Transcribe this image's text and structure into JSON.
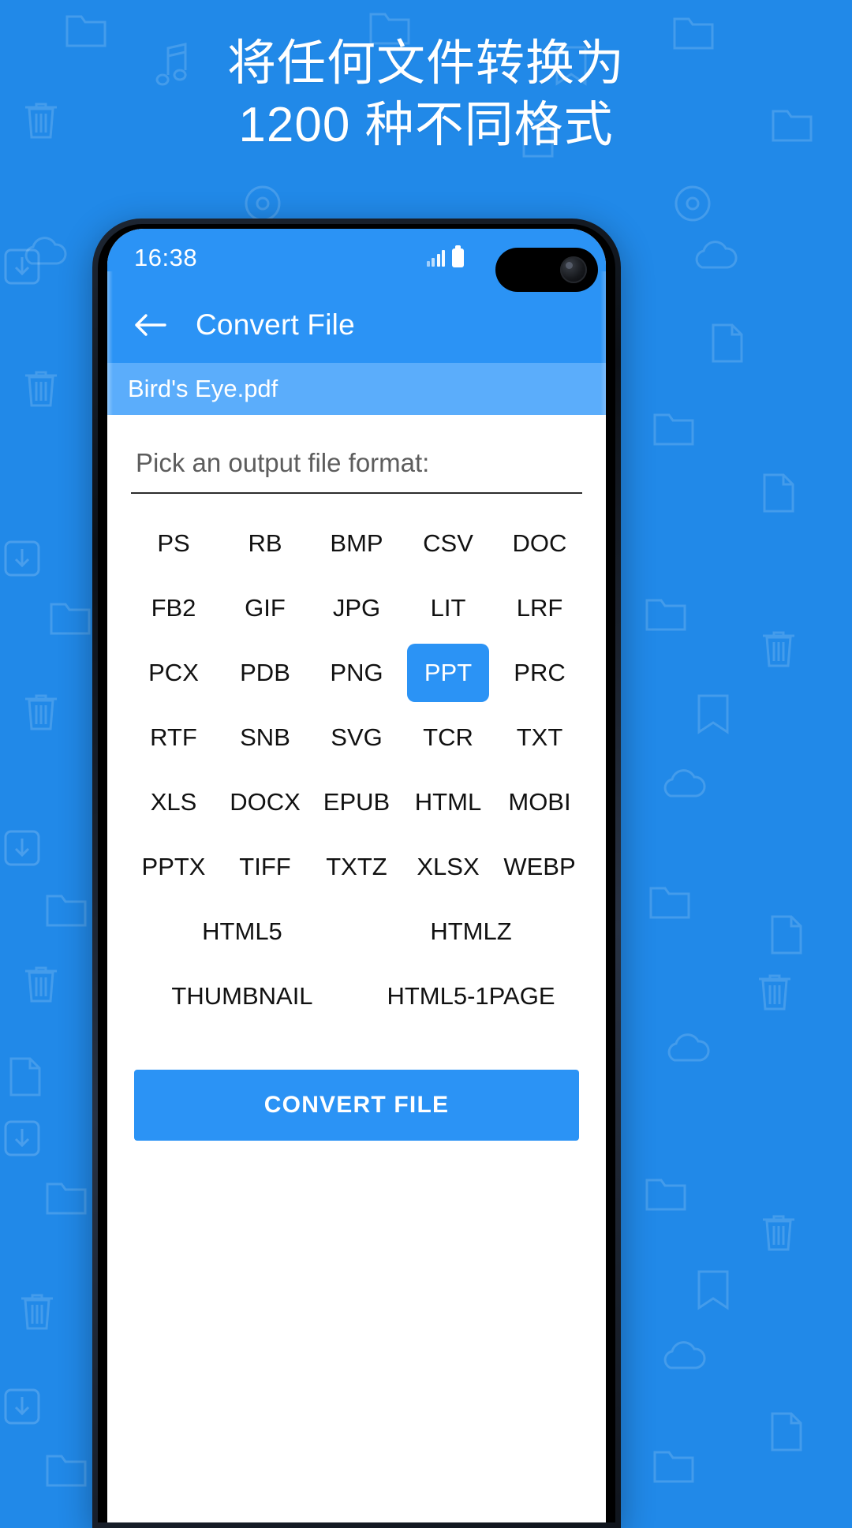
{
  "promo": {
    "line1": "将任何文件转换为",
    "line2": "1200 种不同格式"
  },
  "colors": {
    "background": "#2189e8",
    "accent": "#2b93f5",
    "filebar": "#5badfb",
    "screen": "#ffffff",
    "text_dark": "#111111",
    "label_gray": "#5d5d5d"
  },
  "phone": {
    "statusbar": {
      "time": "16:38",
      "signal_icon": "signal-bars-icon",
      "battery_icon": "battery-full-icon"
    },
    "appbar": {
      "back_icon": "arrow-left-icon",
      "title": "Convert File"
    },
    "filebar": {
      "filename": "Bird's Eye.pdf"
    },
    "content": {
      "pick_label": "Pick an output file format:",
      "formats_grid5": [
        "PS",
        "RB",
        "BMP",
        "CSV",
        "DOC",
        "FB2",
        "GIF",
        "JPG",
        "LIT",
        "LRF",
        "PCX",
        "PDB",
        "PNG",
        "PPT",
        "PRC",
        "RTF",
        "SNB",
        "SVG",
        "TCR",
        "TXT",
        "XLS",
        "DOCX",
        "EPUB",
        "HTML",
        "MOBI",
        "PPTX",
        "TIFF",
        "TXTZ",
        "XLSX",
        "WEBP"
      ],
      "formats_grid2": [
        "HTML5",
        "HTMLZ",
        "THUMBNAIL",
        "HTML5-1PAGE"
      ],
      "selected_format": "PPT",
      "convert_button": "CONVERT FILE"
    }
  }
}
